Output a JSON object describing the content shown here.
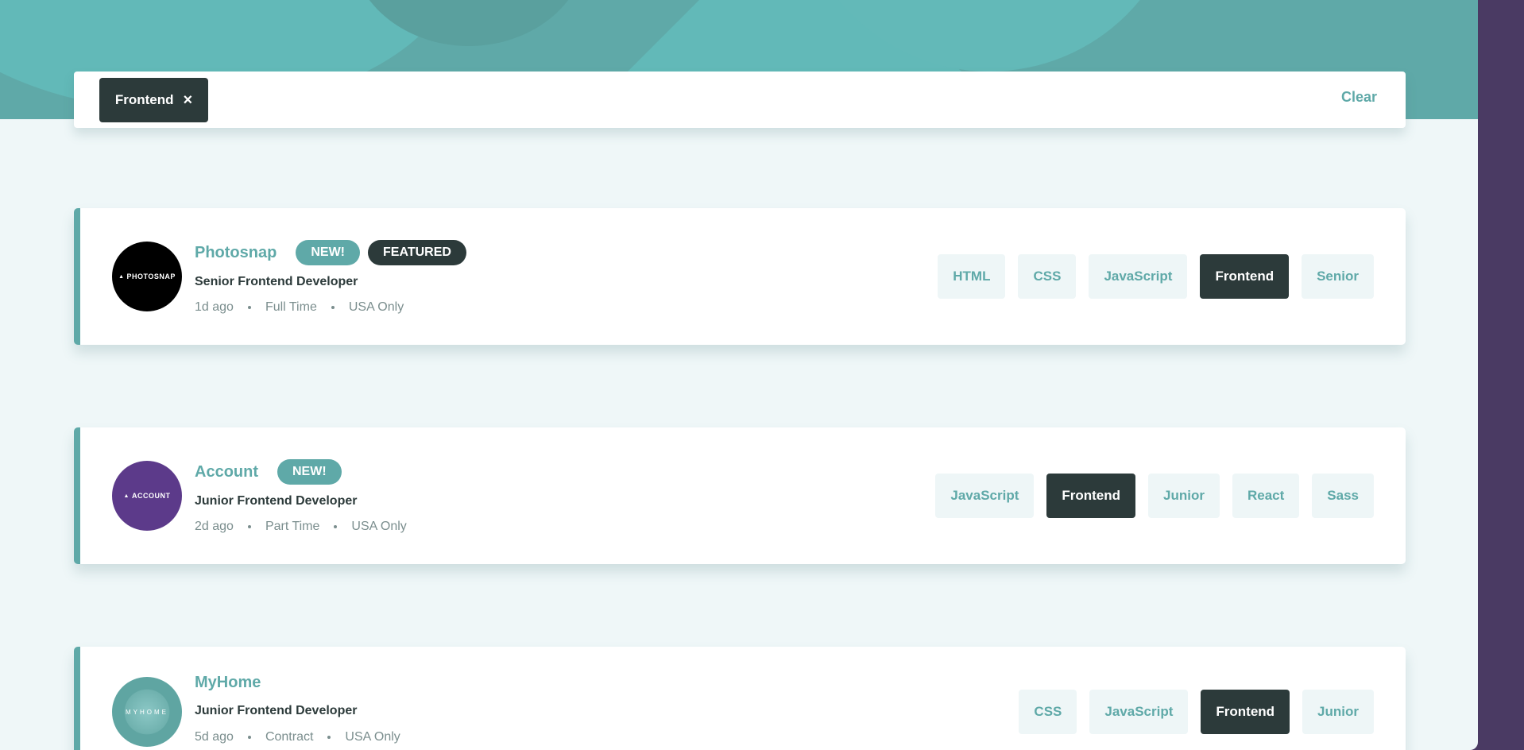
{
  "filter_bar": {
    "chips": [
      {
        "label": "Frontend",
        "remove_icon": "×"
      }
    ],
    "clear_label": "Clear"
  },
  "jobs": [
    {
      "company": "Photosnap",
      "logo_text": "PHOTOSNAP",
      "logo_color": "#000000",
      "is_new": true,
      "is_featured": true,
      "new_label": "NEW!",
      "featured_label": "FEATURED",
      "position": "Senior Frontend Developer",
      "posted": "1d ago",
      "contract": "Full Time",
      "location": "USA Only",
      "tags": [
        "HTML",
        "CSS",
        "JavaScript",
        "Frontend",
        "Senior"
      ]
    },
    {
      "company": "Account",
      "logo_text": "ACCOUNT",
      "logo_color": "#5c3a8a",
      "is_new": true,
      "is_featured": false,
      "new_label": "NEW!",
      "position": "Junior Frontend Developer",
      "posted": "2d ago",
      "contract": "Part Time",
      "location": "USA Only",
      "tags": [
        "JavaScript",
        "Frontend",
        "Junior",
        "React",
        "Sass"
      ]
    },
    {
      "company": "MyHome",
      "logo_text": "MYHOME",
      "logo_color": "#5fa5a2",
      "is_new": false,
      "is_featured": false,
      "position": "Junior Frontend Developer",
      "posted": "5d ago",
      "contract": "Contract",
      "location": "USA Only",
      "tags": [
        "CSS",
        "JavaScript",
        "Frontend",
        "Junior"
      ]
    }
  ],
  "active_filter": "Frontend",
  "colors": {
    "accent": "#5fa9a8",
    "dark": "#2c3a3a",
    "background": "#eff7f8",
    "tag_bg": "#eef6f7"
  }
}
